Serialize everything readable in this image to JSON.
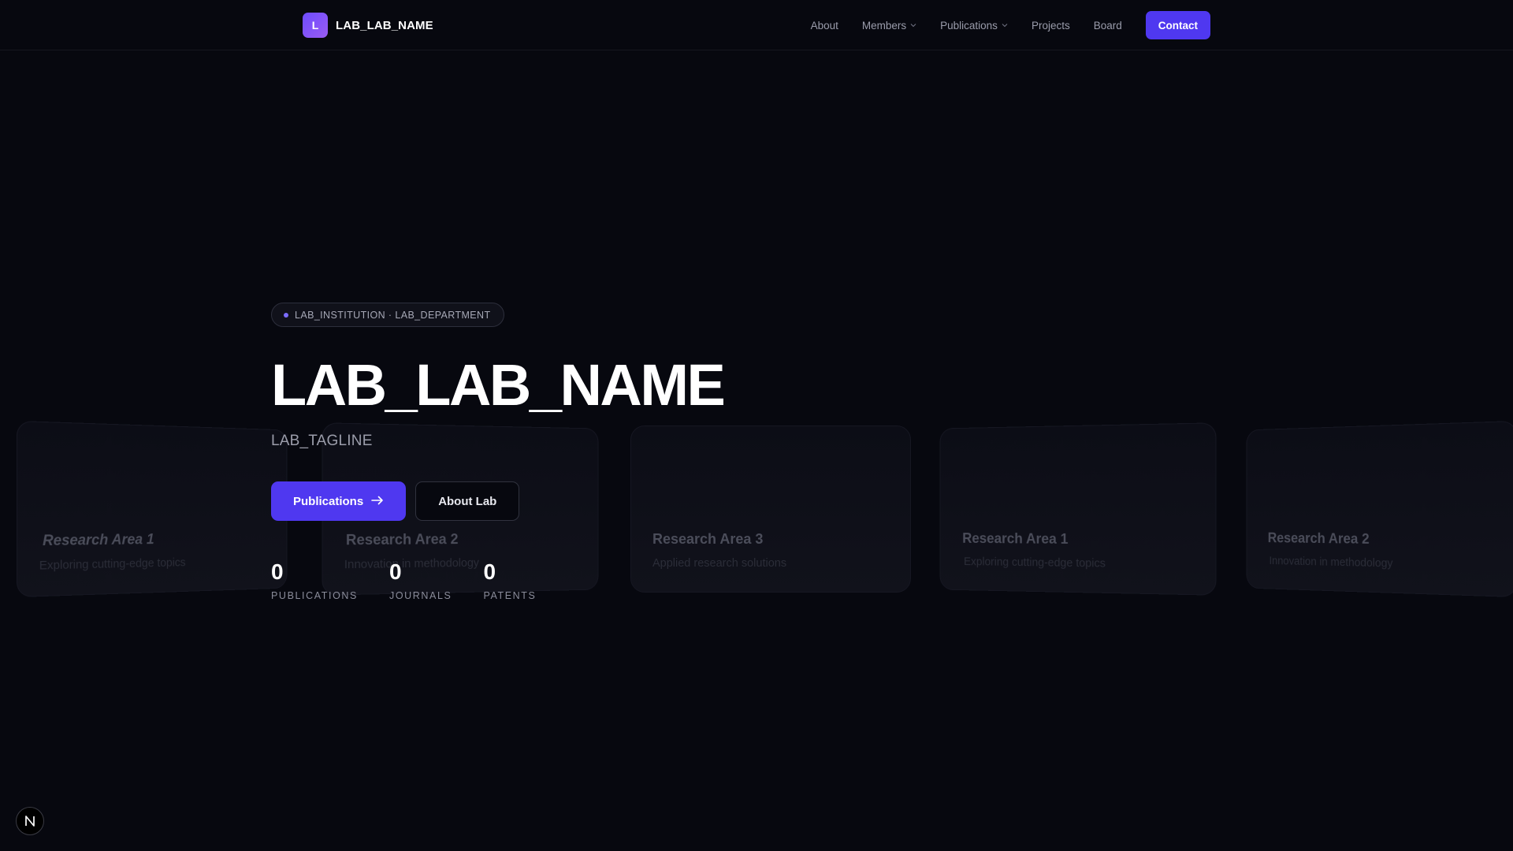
{
  "nav": {
    "brand_initial": "L",
    "brand_name": "LAB_LAB_NAME",
    "links": [
      {
        "label": "About"
      },
      {
        "label": "Members"
      },
      {
        "label": "Publications"
      },
      {
        "label": "Projects"
      },
      {
        "label": "Board"
      }
    ],
    "cta": "Contact"
  },
  "hero": {
    "pill": "LAB_INSTITUTION · LAB_DEPARTMENT",
    "title": "LAB_LAB_NAME",
    "tagline": "LAB_TAGLINE",
    "primary_button": "Publications",
    "secondary_button": "About Lab",
    "stats": [
      {
        "value": "0",
        "label": "PUBLICATIONS"
      },
      {
        "value": "0",
        "label": "JOURNALS"
      },
      {
        "value": "0",
        "label": "PATENTS"
      }
    ]
  },
  "cards": [
    {
      "title": "Research Area 1",
      "desc": "Exploring cutting-edge topics"
    },
    {
      "title": "Research Area 2",
      "desc": "Innovation in methodology"
    },
    {
      "title": "Research Area 3",
      "desc": "Applied research solutions"
    },
    {
      "title": "Research Area 1",
      "desc": "Exploring cutting-edge topics"
    },
    {
      "title": "Research Area 2",
      "desc": "Innovation in methodology"
    }
  ],
  "badge": {
    "letter": "N"
  },
  "colors": {
    "background": "#07080f",
    "accent": "#4f38f0",
    "brand_gradient_start": "#6d4cff",
    "brand_gradient_end": "#9a5cf2"
  },
  "icons": {
    "nav_dropdown": "chevron-down-icon",
    "primary_button": "arrow-right-icon",
    "badge": "n-logo-icon"
  }
}
